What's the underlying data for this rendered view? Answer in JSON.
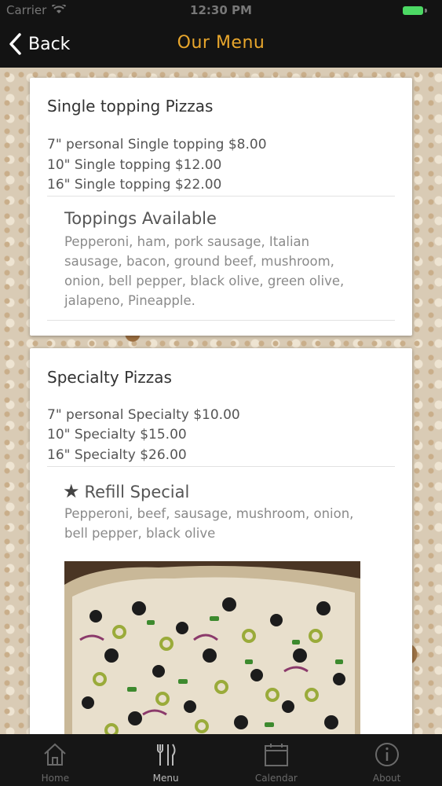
{
  "status_bar": {
    "carrier": "Carrier",
    "time": "12:30 PM"
  },
  "nav": {
    "back_label": "Back",
    "title": "Our Menu"
  },
  "sections": [
    {
      "title": "Single topping Pizzas",
      "prices": [
        "7\" personal Single topping $8.00",
        "10\" Single topping $12.00",
        "16\" Single topping $22.00"
      ],
      "sub_title": "Toppings Available",
      "description": "Pepperoni, ham, pork sausage, Italian sausage, bacon, ground beef, mushroom, onion, bell pepper, black olive, green olive, jalapeno, Pineapple."
    },
    {
      "title": "Specialty Pizzas",
      "prices": [
        "7\" personal Specialty $10.00",
        "10\" Specialty $15.00",
        "16\" Specialty $26.00"
      ],
      "sub_title": "Refill Special",
      "description": "Pepperoni, beef, sausage, mushroom, onion, bell pepper, black olive"
    }
  ],
  "tabs": [
    {
      "label": "Home",
      "icon": "home-icon"
    },
    {
      "label": "Menu",
      "icon": "fork-knife-icon",
      "active": true
    },
    {
      "label": "Calendar",
      "icon": "calendar-icon"
    },
    {
      "label": "About",
      "icon": "info-icon"
    }
  ],
  "colors": {
    "title_accent": "#e8a62c",
    "battery": "#4cd964"
  }
}
